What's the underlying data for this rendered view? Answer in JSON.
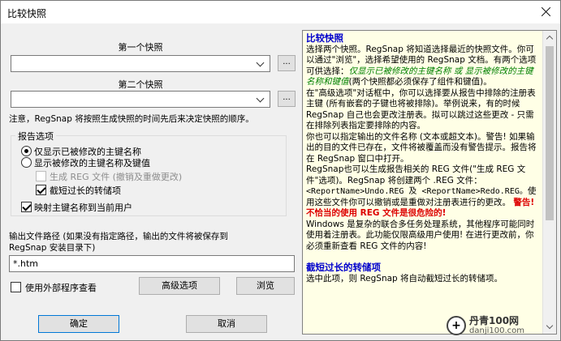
{
  "window": {
    "title": "比较快照"
  },
  "snapshot1": {
    "label": "第一个快照",
    "value": "",
    "browse_label": "..."
  },
  "snapshot2": {
    "label": "第二个快照",
    "value": "",
    "browse_label": "..."
  },
  "note": "注意，RegSnap 将按照生成快照的时间先后来决定快照的顺序。",
  "report_options": {
    "group_label": "报告选项",
    "radio_changed_keys": "仅显示已被修改的主键名称",
    "radio_changed_keys_values": "显示被修改的主键名称及键值",
    "check_generate_reg": "生成 REG 文件 (撤销及重做更改)",
    "check_truncate_dumps": "截短过长的转储项",
    "check_map_hku": "映射主键名称到当前用户"
  },
  "output": {
    "label_line1": "输出文件路径 (如果没有指定路径，输出的文件将被保存到",
    "label_line2": "RegSnap 安装目录下)",
    "path_value": "*.htm"
  },
  "external_viewer": {
    "label": "使用外部程序查看"
  },
  "buttons": {
    "advanced": "高级选项",
    "browse": "浏览",
    "ok": "确定",
    "cancel": "取消"
  },
  "help": {
    "title": "比较快照",
    "p1": "选择两个快照。RegSnap 将知道选择最近的快照文件。你可以通过\"浏览\"，选择希望使用的 RegSnap 文档。有两个选项可供选择：",
    "p1_italic": "仅显示已被修改的主键名称 或 显示被修改的主键名称和键值",
    "p1_tail": "(两个快照都必须保存了组件和键值)。",
    "p2": "在\"高级选项\"对话框中，你可以选择要从报告中排除的注册表主键 (所有嵌套的子键也将被排除)。举例说来，有的时候 RegSnap 自己也会更改注册表。拟可以跳过这些更改 - 只需在排除列表指定要排除的内容。",
    "p3": "你也可以指定输出的文件名称 (文本或超文本)。警告! 如果输出的目的文件已存在，文件将被覆盖而没有警告提示。报告将在 RegSnap 窗口中打开。",
    "p4": "RegSnap也可以生成报告相关的 REG 文件(\"生成 REG 文件\"选项)。RegSnap 将创建两个 .REG 文件：",
    "p4_files": "<ReportName>Undo.REG 及 <ReportName>Redo.REG。",
    "p4_tail": "使用这些文件你可以撤销或是重做对注册表进行的更改。",
    "warning": "警告! 不恰当的使用 REG 文件是很危险的!",
    "p5": "Windows 是复杂的联合多任务处理系统，其他程序可能同时使用着注册表。此功能仅限高级用户使用! 在进行更改前，你必须重新查看 REG 文件的内容!",
    "title2": "截短过长的转储项",
    "p6": "选中此项，则 RegSnap 将自动截短过长的转储项。"
  },
  "watermark": {
    "brand": "丹青100网",
    "site": "danji100.com"
  }
}
